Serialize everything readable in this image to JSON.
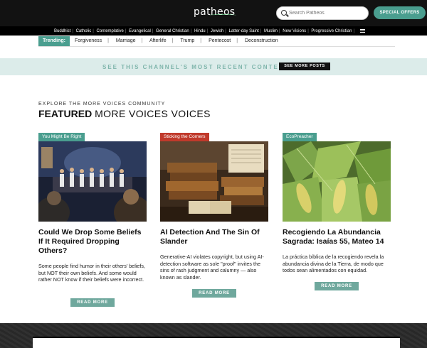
{
  "header": {
    "logo_text": "patheos",
    "search_placeholder": "Search Patheos",
    "special_offers_label": "SPECIAL OFFERS"
  },
  "categories": [
    "Buddhist",
    "Catholic",
    "Contemplative",
    "Evangelical",
    "General Christian",
    "Hindu",
    "Jewish",
    "Latter-day Saint",
    "Muslim",
    "New Visions",
    "Progressive Christian"
  ],
  "trending": {
    "label": "Trending:",
    "items": [
      "Forgiveness",
      "Marriage",
      "Afterlife",
      "Trump",
      "Pentecost",
      "Deconstruction"
    ]
  },
  "channel": {
    "text": "SEE THIS CHANNEL'S MOST RECENT CONTENT",
    "button_label": "SEE MORE POSTS"
  },
  "section": {
    "kicker": "EXPLORE THE MORE VOICES COMMUNITY",
    "title_bold": "FEATURED",
    "title_rest": "MORE VOICES VOICES"
  },
  "cards": [
    {
      "tag": "You Might Be Right",
      "tag_color": "#4a9e8f",
      "title": "Could We Drop Some Beliefs If It Required Dropping Others?",
      "excerpt": "Some people find humor in their others' beliefs, but NOT their own beliefs. And some would rather NOT know if their beliefs were incorrect.",
      "read_more": "READ MORE"
    },
    {
      "tag": "Sticking the Corners",
      "tag_color": "#c0392b",
      "title": "AI Detection And The Sin Of Slander",
      "excerpt": "Generative-AI violates copyright, but using AI-detection software as sole \"proof\" invites the sins of rash judgment and calumny — also known as slander.",
      "read_more": "READ MORE"
    },
    {
      "tag": "EcoPreacher",
      "tag_color": "#4a9e8f",
      "title": "Recogiendo La Abundancia Sagrada: Isaías 55, Mateo 14",
      "excerpt": "La práctica bíblica de la recogiendo revela la abundancia divina de la Tierra, de modo que todos sean alimentados con equidad.",
      "read_more": "READ MORE"
    }
  ],
  "colors": {
    "accent": "#4a9e8f",
    "channel_bg": "#dcecea",
    "topbar_bg": "#121212"
  }
}
